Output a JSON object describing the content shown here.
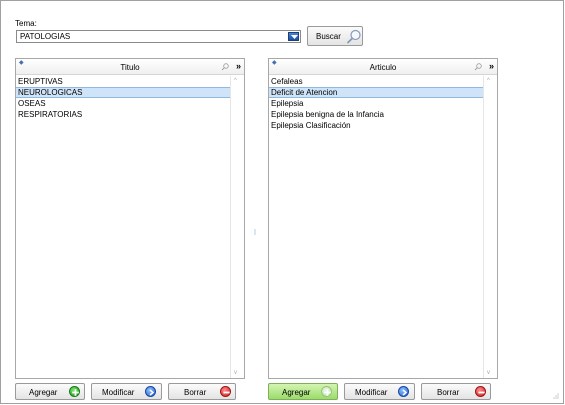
{
  "tema": {
    "label": "Tema:",
    "selected": "PATOLOGIAS"
  },
  "buscar_label": "Buscar",
  "left_panel": {
    "column_header": "Titulo",
    "items": [
      "ERUPTIVAS",
      "NEUROLOGICAS",
      "OSEAS",
      "RESPIRATORIAS"
    ],
    "selected_index": 1
  },
  "right_panel": {
    "column_header": "Articulo",
    "items": [
      "Cefaleas",
      "Deficit de Atencion",
      "Epilepsia",
      "Epilepsia benigna de la Infancia",
      "Epilepsia Clasificación"
    ],
    "selected_index": 1
  },
  "left_buttons": {
    "add": "Agregar",
    "modify": "Modificar",
    "delete": "Borrar"
  },
  "right_buttons": {
    "add": "Agregar",
    "modify": "Modificar",
    "delete": "Borrar"
  },
  "icons": {
    "add": "plus-circle-icon",
    "modify": "arrow-circle-icon",
    "delete": "minus-circle-icon",
    "search": "magnifier-icon",
    "dropdown": "chevron-down-icon"
  },
  "colors": {
    "selection": "#cfe4f8",
    "add_green": "#1c9a1c",
    "modify_blue": "#1f5fd1",
    "delete_red": "#d11b1b"
  }
}
